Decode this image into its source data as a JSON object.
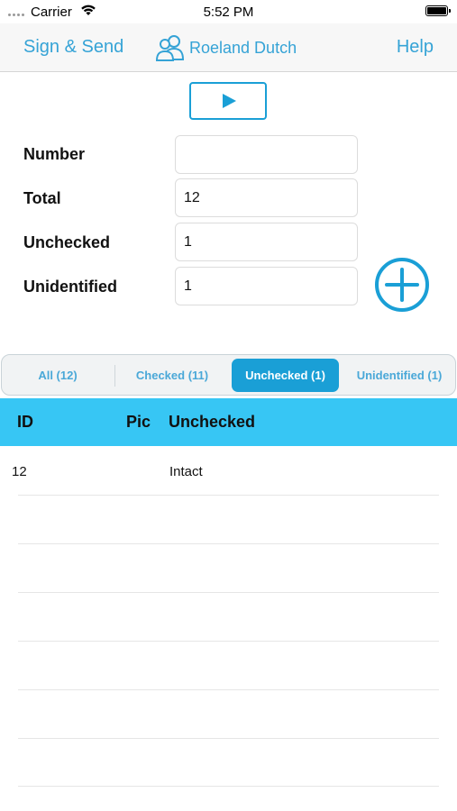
{
  "status_bar": {
    "carrier": "Carrier",
    "time": "5:52 PM"
  },
  "nav": {
    "left_label": "Sign & Send",
    "user_name": "Roeland Dutch",
    "right_label": "Help"
  },
  "form": {
    "fields": [
      {
        "label": "Number",
        "value": ""
      },
      {
        "label": "Total",
        "value": "12"
      },
      {
        "label": "Unchecked",
        "value": "1"
      },
      {
        "label": "Unidentified",
        "value": "1"
      }
    ]
  },
  "tabs": [
    {
      "label": "All (12)",
      "active": false
    },
    {
      "label": "Checked (11)",
      "active": false
    },
    {
      "label": "Unchecked (1)",
      "active": true
    },
    {
      "label": "Unidentified (1)",
      "active": false
    }
  ],
  "table": {
    "headers": {
      "id": "ID",
      "pic": "Pic",
      "status": "Unchecked"
    },
    "rows": [
      {
        "id": "12",
        "pic": "",
        "status": "Intact"
      }
    ]
  },
  "colors": {
    "accent": "#1a9fd6",
    "nav_text": "#35a3d6",
    "table_header": "#37c6f4"
  },
  "icons": {
    "wifi": "wifi-icon",
    "battery": "battery-icon",
    "user": "users-icon",
    "play": "play-icon",
    "add": "add-circle-icon"
  }
}
